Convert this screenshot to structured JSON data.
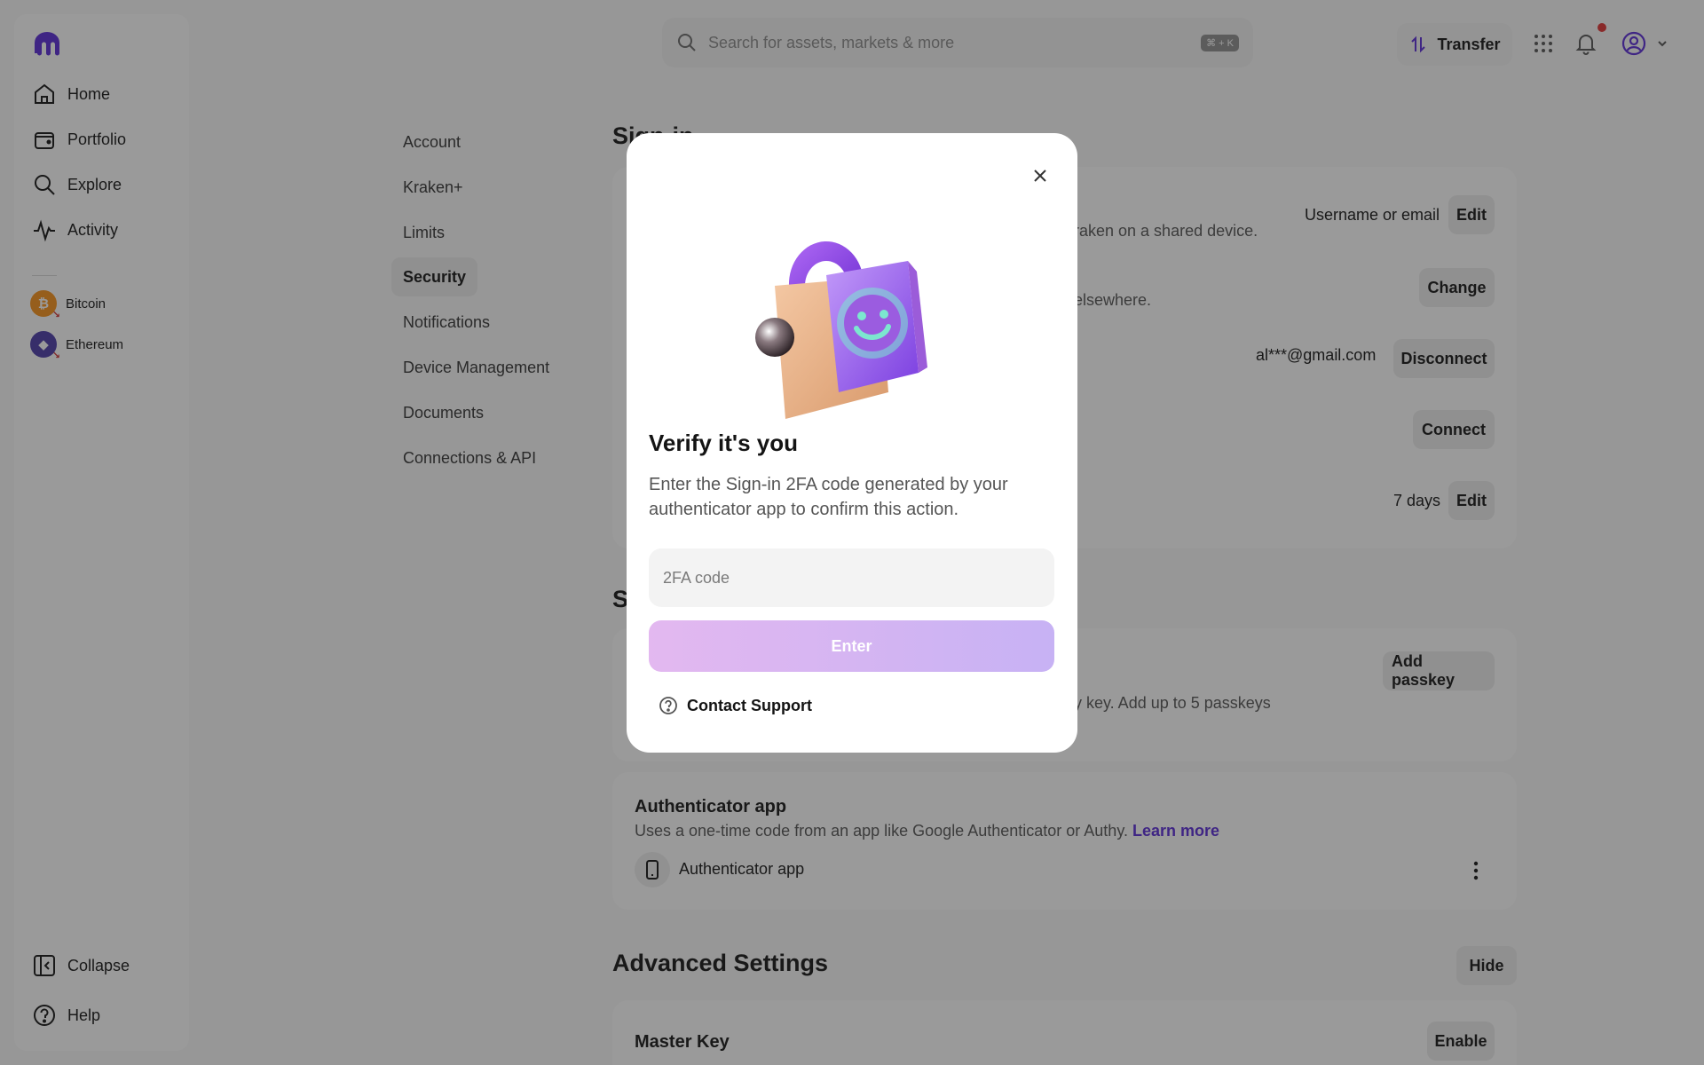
{
  "sidebar": {
    "nav": [
      {
        "label": "Home",
        "icon": "home-icon"
      },
      {
        "label": "Portfolio",
        "icon": "wallet-icon"
      },
      {
        "label": "Explore",
        "icon": "search-icon"
      },
      {
        "label": "Activity",
        "icon": "activity-icon"
      }
    ],
    "assets": [
      {
        "label": "Bitcoin",
        "symbol": "₿",
        "color": "#f7931a"
      },
      {
        "label": "Ethereum",
        "symbol": "◆",
        "color": "#4b3ba8"
      }
    ],
    "collapse_label": "Collapse",
    "help_label": "Help"
  },
  "topbar": {
    "search_placeholder": "Search for assets, markets & more",
    "search_shortcut": "⌘ + K",
    "transfer_label": "Transfer"
  },
  "settings_nav": [
    "Account",
    "Kraken+",
    "Limits",
    "Security",
    "Notifications",
    "Device Management",
    "Documents",
    "Connections & API"
  ],
  "sign_in": {
    "title": "Sign-in",
    "rows": [
      {
        "desc_tail": "raken on a shared device.",
        "value": "Username or email",
        "action": "Edit"
      },
      {
        "desc_tail": "elsewhere.",
        "value": "",
        "action": "Change"
      },
      {
        "desc_tail": "",
        "value": "al***@gmail.com",
        "action": "Disconnect"
      },
      {
        "desc_tail": "",
        "value": "",
        "action": "Connect"
      },
      {
        "desc_tail": "",
        "value": "7 days",
        "action": "Edit"
      }
    ]
  },
  "second_section": {
    "title_fragment": "S",
    "passkey_desc_tail": "y key. Add up to 5 passkeys",
    "passkey_action": "Add passkey"
  },
  "authenticator": {
    "title": "Authenticator app",
    "desc": "Uses a one-time code from an app like Google Authenticator or Authy.",
    "learn_more": "Learn more",
    "item_label": "Authenticator app"
  },
  "advanced": {
    "title": "Advanced Settings",
    "hide_label": "Hide",
    "master_key_label": "Master Key",
    "enable_label": "Enable"
  },
  "modal": {
    "title": "Verify it's you",
    "description": "Enter the Sign-in 2FA code generated by your authenticator app to confirm this action.",
    "input_placeholder": "2FA code",
    "enter_label": "Enter",
    "support_label": "Contact Support"
  },
  "colors": {
    "accent": "#5a2bd8",
    "overlay": "rgba(30,30,30,0.45)"
  }
}
